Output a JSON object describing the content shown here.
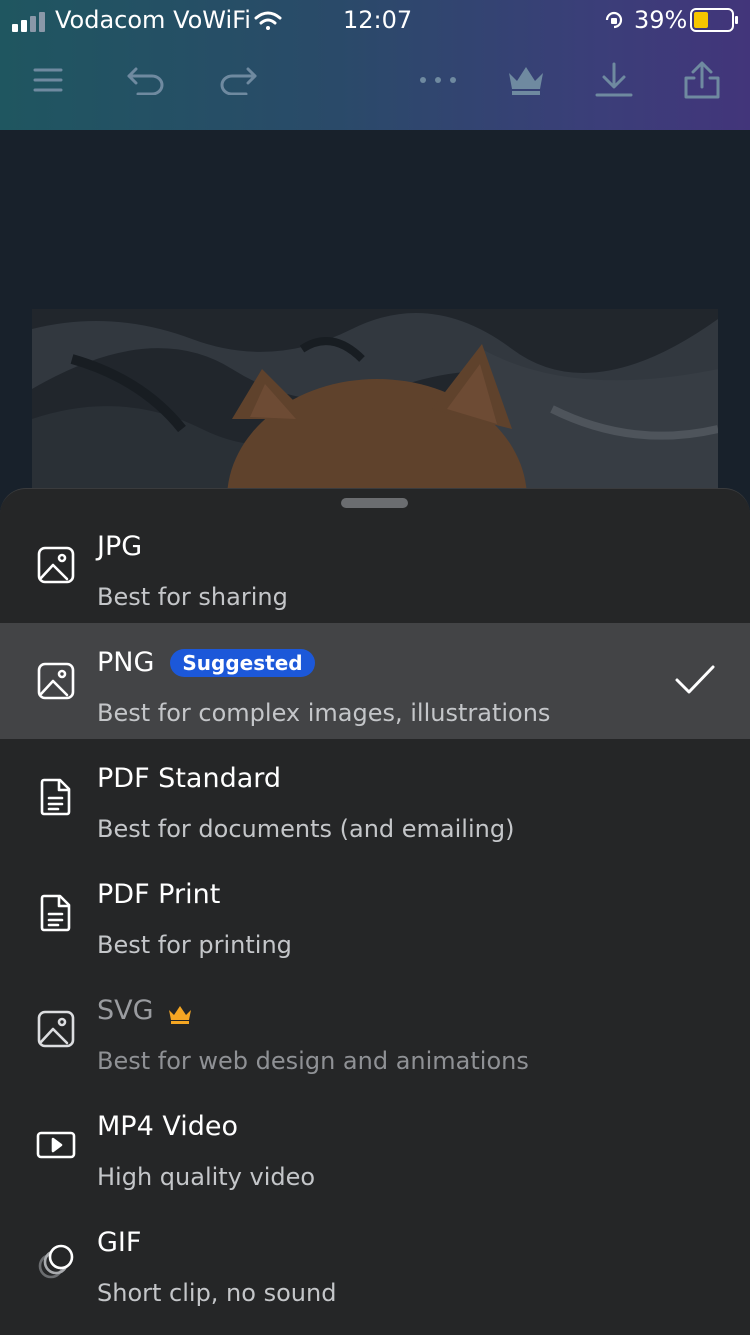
{
  "status_bar": {
    "carrier": "Vodacom VoWiFi",
    "time": "12:07",
    "battery_percent": "39%",
    "battery_level": 0.39,
    "battery_color": "#f7c600"
  },
  "toolbar": {
    "icons": [
      "menu-icon",
      "undo-icon",
      "redo-icon",
      "more-icon",
      "crown-icon",
      "download-icon",
      "share-icon"
    ]
  },
  "export_options": [
    {
      "title": "JPG",
      "subtitle": "Best for sharing",
      "icon": "image-icon"
    },
    {
      "title": "PNG",
      "badge": "Suggested",
      "subtitle": "Best for complex images, illustrations",
      "icon": "image-icon",
      "selected": true
    },
    {
      "title": "PDF Standard",
      "subtitle": "Best for documents (and emailing)",
      "icon": "document-icon"
    },
    {
      "title": "PDF Print",
      "subtitle": "Best for printing",
      "icon": "document-icon"
    },
    {
      "title": "SVG",
      "subtitle": "Best for web design and animations",
      "icon": "image-icon",
      "premium": true
    },
    {
      "title": "MP4 Video",
      "subtitle": "High quality video",
      "icon": "video-icon"
    },
    {
      "title": "GIF",
      "subtitle": "Short clip, no sound",
      "icon": "gif-icon"
    }
  ],
  "colors": {
    "badge": "#1c58d9",
    "premium_crown": "#f5a623",
    "sheet_bg": "#252627",
    "selected_row": "#434446"
  }
}
